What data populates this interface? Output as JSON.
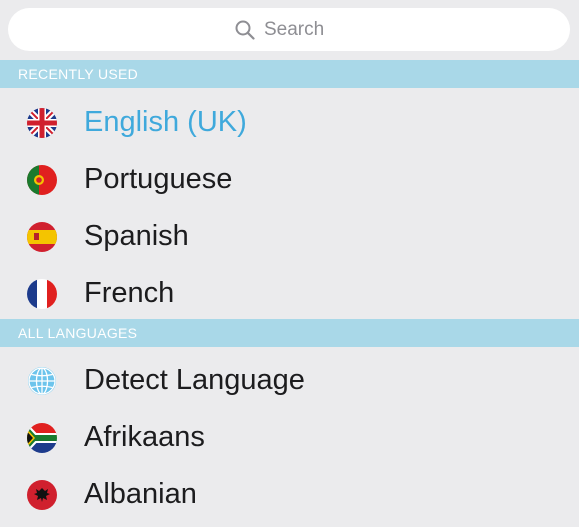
{
  "search": {
    "placeholder": "Search",
    "icon": "search-icon"
  },
  "colors": {
    "section_header_bg": "#a9d8e8",
    "selected_text": "#3fa9dc",
    "background": "#ebebed"
  },
  "sections": [
    {
      "title": "RECENTLY USED",
      "items": [
        {
          "label": "English (UK)",
          "icon": "uk-flag-icon",
          "selected": true
        },
        {
          "label": "Portuguese",
          "icon": "portugal-flag-icon",
          "selected": false
        },
        {
          "label": "Spanish",
          "icon": "spain-flag-icon",
          "selected": false
        },
        {
          "label": "French",
          "icon": "france-flag-icon",
          "selected": false
        }
      ]
    },
    {
      "title": "ALL LANGUAGES",
      "items": [
        {
          "label": "Detect Language",
          "icon": "globe-icon",
          "selected": false
        },
        {
          "label": "Afrikaans",
          "icon": "south-africa-flag-icon",
          "selected": false
        },
        {
          "label": "Albanian",
          "icon": "albania-flag-icon",
          "selected": false
        }
      ]
    }
  ]
}
